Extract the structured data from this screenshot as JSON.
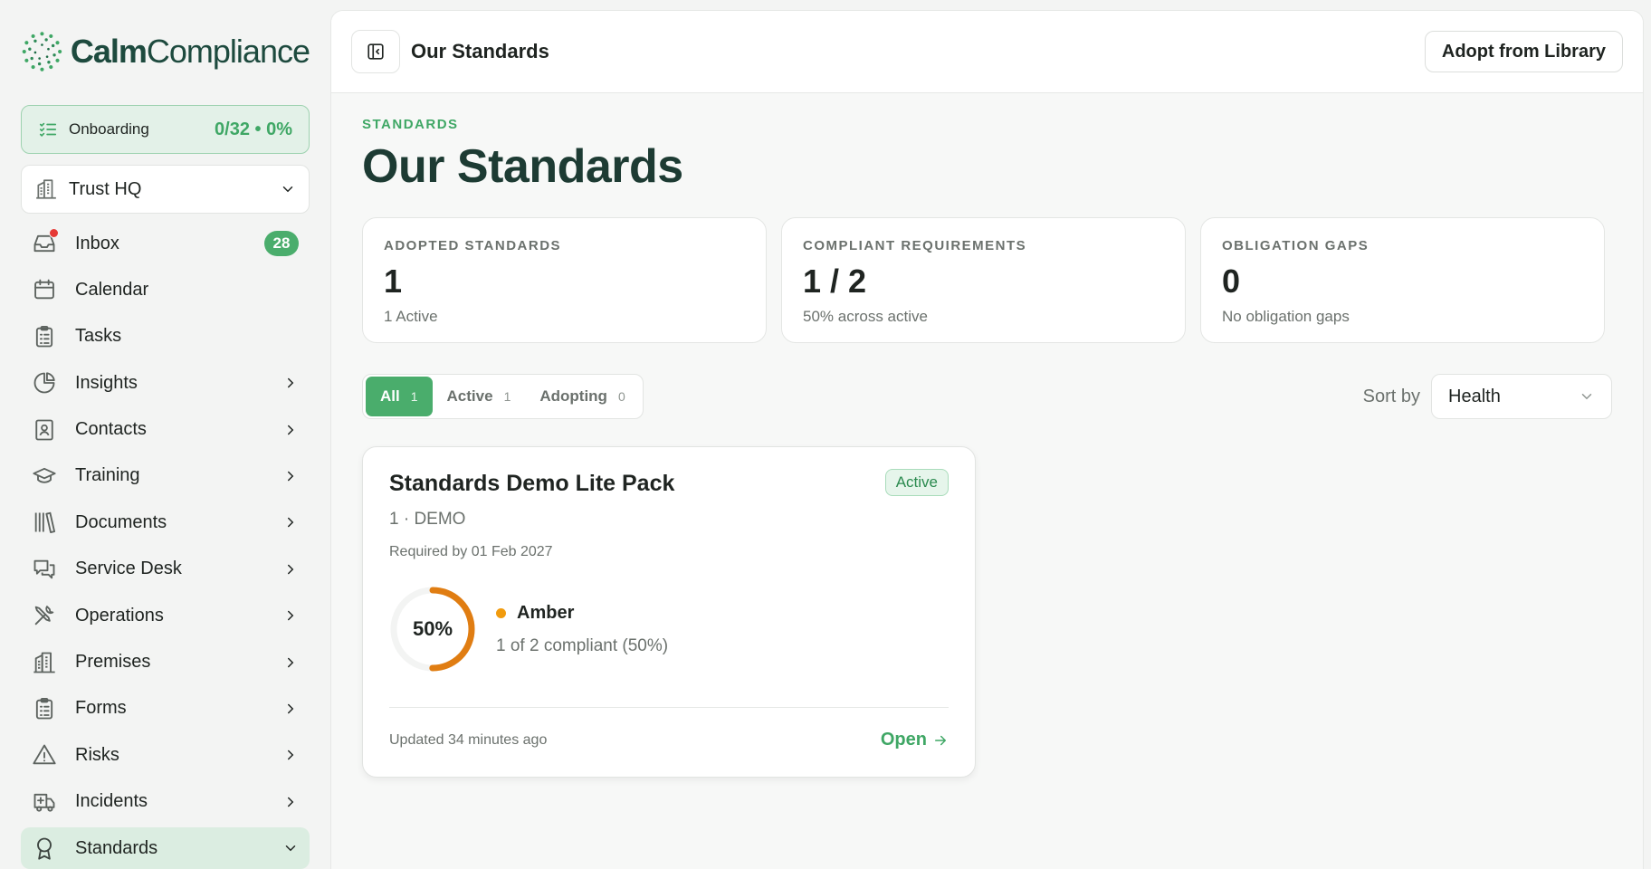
{
  "brand": {
    "name_bold": "Calm",
    "name_regular": "Compliance"
  },
  "onboarding": {
    "label": "Onboarding",
    "progress": "0/32 • 0%"
  },
  "workspace": {
    "label": "Trust HQ"
  },
  "sidebar": {
    "items": [
      {
        "label": "Inbox",
        "icon": "inbox-icon",
        "badge": "28"
      },
      {
        "label": "Calendar",
        "icon": "calendar-icon"
      },
      {
        "label": "Tasks",
        "icon": "clipboard-icon"
      },
      {
        "label": "Insights",
        "icon": "pie-chart-icon"
      },
      {
        "label": "Contacts",
        "icon": "contact-book-icon"
      },
      {
        "label": "Training",
        "icon": "graduation-cap-icon"
      },
      {
        "label": "Documents",
        "icon": "books-icon"
      },
      {
        "label": "Service Desk",
        "icon": "chat-bubbles-icon"
      },
      {
        "label": "Operations",
        "icon": "tools-icon"
      },
      {
        "label": "Premises",
        "icon": "building-icon"
      },
      {
        "label": "Forms",
        "icon": "form-icon"
      },
      {
        "label": "Risks",
        "icon": "warning-icon"
      },
      {
        "label": "Incidents",
        "icon": "ambulance-icon"
      },
      {
        "label": "Standards",
        "icon": "award-icon"
      }
    ]
  },
  "topbar": {
    "title": "Our Standards",
    "adopt_label": "Adopt from Library"
  },
  "page": {
    "eyebrow": "STANDARDS",
    "title": "Our Standards"
  },
  "stats": [
    {
      "label": "ADOPTED STANDARDS",
      "value": "1",
      "sub": "1 Active"
    },
    {
      "label": "COMPLIANT REQUIREMENTS",
      "value": "1 / 2",
      "sub": "50% across active"
    },
    {
      "label": "OBLIGATION GAPS",
      "value": "0",
      "sub": "No obligation gaps"
    }
  ],
  "filters": {
    "tabs": [
      {
        "label": "All",
        "count": "1"
      },
      {
        "label": "Active",
        "count": "1"
      },
      {
        "label": "Adopting",
        "count": "0"
      }
    ],
    "sort_label": "Sort by",
    "sort_value": "Health"
  },
  "standard_card": {
    "title": "Standards Demo Lite Pack",
    "status": "Active",
    "code": "1 · DEMO",
    "required_by": "Required by 01 Feb 2027",
    "health_percent": "50%",
    "health_fraction": 0.5,
    "health_name": "Amber",
    "health_desc": "1 of 2 compliant (50%)",
    "updated": "Updated 34 minutes ago",
    "open_label": "Open"
  },
  "colors": {
    "accent": "#4aad6c",
    "brand_dark": "#1d4a3e",
    "amber": "#f19b0e",
    "ring_orange": "#e07d12"
  }
}
